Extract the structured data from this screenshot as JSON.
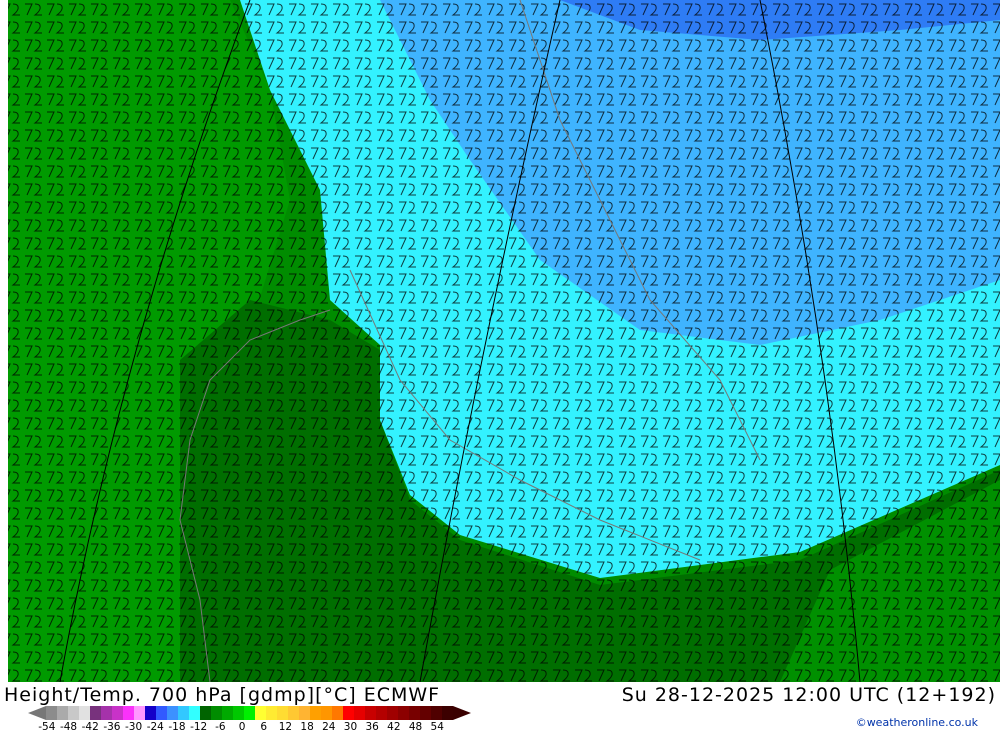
{
  "title_left": "Height/Temp. 700 hPa [gdmp][°C] ECMWF",
  "title_right": "Su 28-12-2025 12:00 UTC (12+192)",
  "credit": "©weatheronline.co.uk",
  "legend": {
    "ticks": [
      "-54",
      "-48",
      "-42",
      "-36",
      "-30",
      "-24",
      "-18",
      "-12",
      "-6",
      "0",
      "6",
      "12",
      "18",
      "24",
      "30",
      "36",
      "42",
      "48",
      "54"
    ],
    "colors": [
      "#8c8c8c",
      "#aaaaaa",
      "#c8c8c8",
      "#e1e1e1",
      "#78327d",
      "#a532aa",
      "#c832c8",
      "#fa32fa",
      "#ff96ff",
      "#1400c8",
      "#325aff",
      "#3c91ff",
      "#32c8ff",
      "#32ffff",
      "#006400",
      "#008c00",
      "#00aa00",
      "#00c800",
      "#00f000",
      "#ffff32",
      "#ffeb32",
      "#ffdc32",
      "#ffc832",
      "#ffb432",
      "#ffa000",
      "#ff9600",
      "#ff7800",
      "#ff0000",
      "#e60000",
      "#c80000",
      "#b40000",
      "#a00000",
      "#8c0000",
      "#780000",
      "#640000",
      "#500000",
      "#3c0000"
    ]
  },
  "colors": {
    "cyan": "#33f2ff",
    "blue": "#3fb4ff",
    "deep_blue": "#2e7cf5",
    "green_light": "#009a00",
    "green_dark": "#006e00"
  }
}
